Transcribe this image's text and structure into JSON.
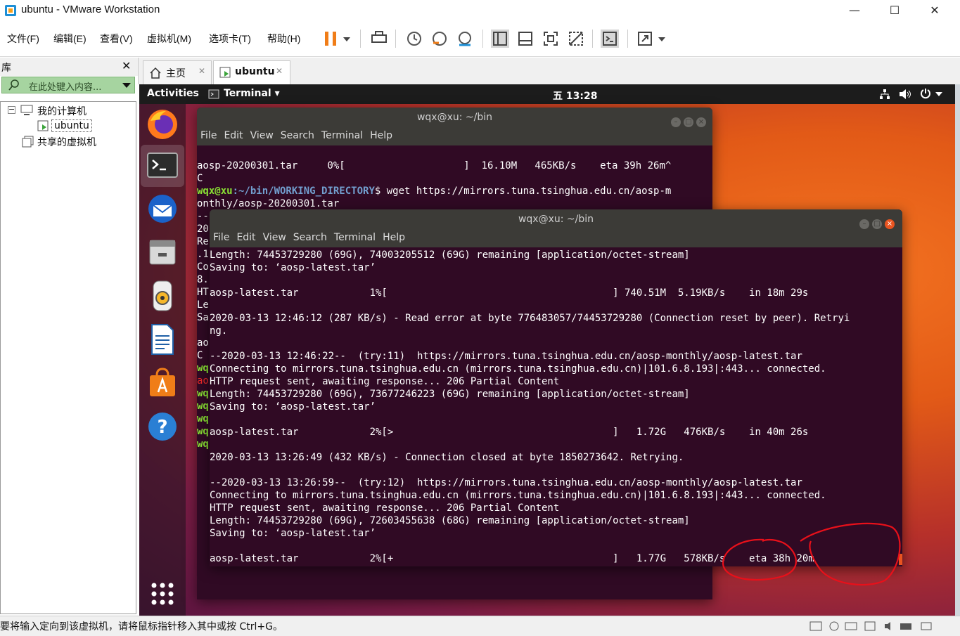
{
  "window": {
    "title": "ubuntu - VMware Workstation",
    "minimize": "—",
    "maximize": "☐",
    "close": "✕"
  },
  "menubar": {
    "items": [
      "文件(F)",
      "编辑(E)",
      "查看(V)",
      "虚拟机(M)",
      "选项卡(T)",
      "帮助(H)"
    ]
  },
  "library": {
    "title": "库",
    "close": "✕",
    "search_placeholder": "在此处键入内容...",
    "tree": {
      "my_computer": "我的计算机",
      "vm_ubuntu": "ubuntu",
      "shared": "共享的虚拟机"
    }
  },
  "vm_tabs": {
    "home": "主页",
    "ubuntu": "ubuntu",
    "close": "✕"
  },
  "ubuntu": {
    "activities": "Activities",
    "app_menu": "Terminal ▾",
    "clock": "五 13:28"
  },
  "terminal_back": {
    "title": "wqx@xu: ~/bin",
    "menu": [
      "File",
      "Edit",
      "View",
      "Search",
      "Terminal",
      "Help"
    ],
    "line1": "aosp-20200301.tar     0%[                    ]  16.10M   465KB/s    eta 39h 26m^",
    "line2": "C",
    "prompt_user": "wqx@xu",
    "prompt_path": ":~/bin/WORKING_DIRECTORY",
    "prompt_cmd": "$ wget https://mirrors.tuna.tsinghua.edu.cn/aosp-m",
    "line4": "onthly/aosp-20200301.tar",
    "left_col": [
      "--",
      "20",
      "Re",
      ".1",
      "Co",
      "8.",
      "HT",
      "Le",
      "Sa",
      "",
      "ao",
      "C",
      "wq",
      "ao",
      "wq",
      "wq",
      "wq",
      "wq",
      "wq"
    ]
  },
  "terminal_front": {
    "title": "wqx@xu: ~/bin",
    "menu": [
      "File",
      "Edit",
      "View",
      "Search",
      "Terminal",
      "Help"
    ],
    "lines": [
      "Length: 74453729280 (69G), 74003205512 (69G) remaining [application/octet-stream]",
      "Saving to: ‘aosp-latest.tar’",
      "",
      "aosp-latest.tar            1%[                                      ] 740.51M  5.19KB/s    in 18m 29s",
      "",
      "2020-03-13 12:46:12 (287 KB/s) - Read error at byte 776483057/74453729280 (Connection reset by peer). Retryi",
      "ng.",
      "",
      "--2020-03-13 12:46:22--  (try:11)  https://mirrors.tuna.tsinghua.edu.cn/aosp-monthly/aosp-latest.tar",
      "Connecting to mirrors.tuna.tsinghua.edu.cn (mirrors.tuna.tsinghua.edu.cn)|101.6.8.193|:443... connected.",
      "HTTP request sent, awaiting response... 206 Partial Content",
      "Length: 74453729280 (69G), 73677246223 (69G) remaining [application/octet-stream]",
      "Saving to: ‘aosp-latest.tar’",
      "",
      "aosp-latest.tar            2%[>                                     ]   1.72G   476KB/s    in 40m 26s",
      "",
      "2020-03-13 13:26:49 (432 KB/s) - Connection closed at byte 1850273642. Retrying.",
      "",
      "--2020-03-13 13:26:59--  (try:12)  https://mirrors.tuna.tsinghua.edu.cn/aosp-monthly/aosp-latest.tar",
      "Connecting to mirrors.tuna.tsinghua.edu.cn (mirrors.tuna.tsinghua.edu.cn)|101.6.8.193|:443... connected.",
      "HTTP request sent, awaiting response... 206 Partial Content",
      "Length: 74453729280 (69G), 72603455638 (68G) remaining [application/octet-stream]",
      "Saving to: ‘aosp-latest.tar’",
      "",
      "aosp-latest.tar            2%[+                                     ]   1.77G   578KB/s    eta 38h 20m"
    ]
  },
  "statusbar": {
    "message": "要将输入定向到该虚拟机，请将鼠标指针移入其中或按 Ctrl+G。"
  },
  "colors": {
    "terminal_bg": "#300a24",
    "ubuntu_orange": "#e95420",
    "annotation_red": "#e8101a"
  }
}
